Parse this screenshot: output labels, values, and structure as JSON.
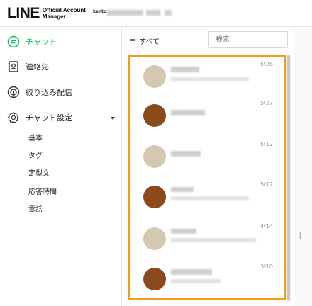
{
  "header": {
    "logo_main": "LINE",
    "logo_sub_line1": "Official Account",
    "logo_sub_line2": "Manager",
    "account_name": "kento"
  },
  "sidebar": {
    "items": [
      {
        "label": "チャット",
        "icon": "chat-bubble-icon",
        "active": true
      },
      {
        "label": "連絡先",
        "icon": "contacts-icon",
        "active": false
      },
      {
        "label": "絞り込み配信",
        "icon": "broadcast-icon",
        "active": false
      },
      {
        "label": "チャット設定",
        "icon": "gear-icon",
        "active": false
      }
    ],
    "sub_items": [
      "基本",
      "タグ",
      "定型文",
      "応答時間",
      "電話"
    ]
  },
  "list": {
    "filter_label": "すべて",
    "search_placeholder": "検索",
    "conversations": [
      {
        "date": "5/28",
        "avatar": "light"
      },
      {
        "date": "5/27",
        "avatar": "brown"
      },
      {
        "date": "5/12",
        "avatar": "light"
      },
      {
        "date": "5/12",
        "avatar": "brown"
      },
      {
        "date": "4/14",
        "avatar": "light"
      },
      {
        "date": "3/10",
        "avatar": "brown"
      }
    ]
  },
  "colors": {
    "accent_green": "#06c755",
    "highlight_orange": "#f59a1b",
    "avatar_light": "#d6c8b0",
    "avatar_brown": "#8b4a1c"
  }
}
